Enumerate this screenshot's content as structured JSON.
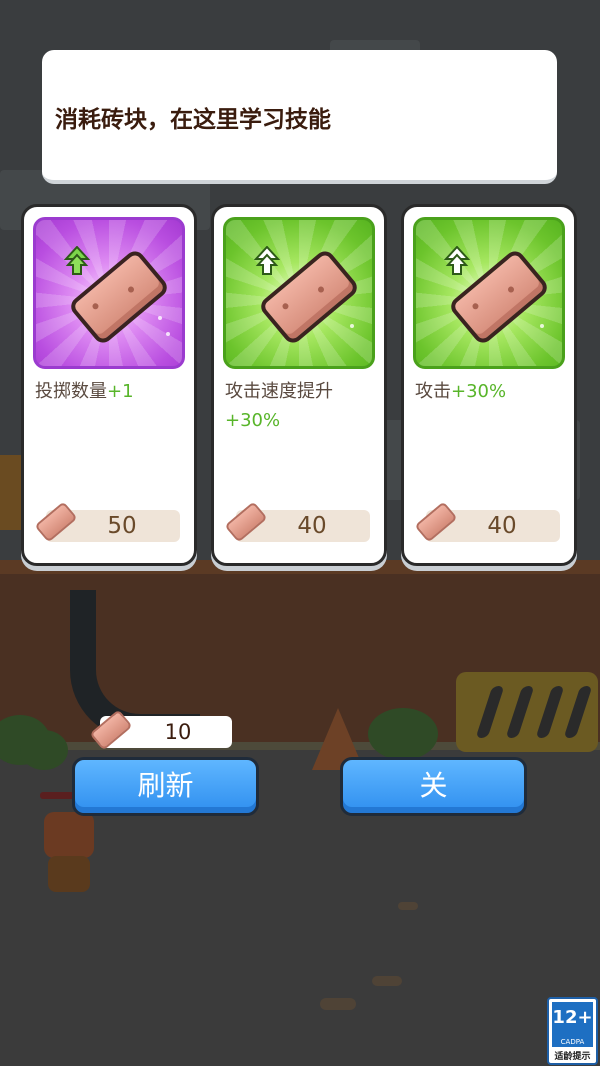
{
  "header": {
    "text": "消耗砖块，在这里学习技能"
  },
  "cards": [
    {
      "desc_main": "投掷数量",
      "desc_bonus": "+1",
      "price": "50",
      "theme": "purple"
    },
    {
      "desc_main": "攻击速度提升",
      "desc_bonus": "+30%",
      "price": "40",
      "theme": "green"
    },
    {
      "desc_main": "攻击",
      "desc_bonus": "+30%",
      "price": "40",
      "theme": "green"
    }
  ],
  "currency": {
    "amount": "10",
    "icon": "brick-icon"
  },
  "buttons": {
    "refresh": "刷新",
    "close": "关"
  },
  "age_rating": {
    "label": "12+",
    "org": "CADPA",
    "caption": "适龄提示"
  },
  "colors": {
    "bonus_green": "#58b52a",
    "button_blue": "#3a9bf6",
    "purple_art": "#c061e6",
    "green_art": "#7ed13a"
  }
}
